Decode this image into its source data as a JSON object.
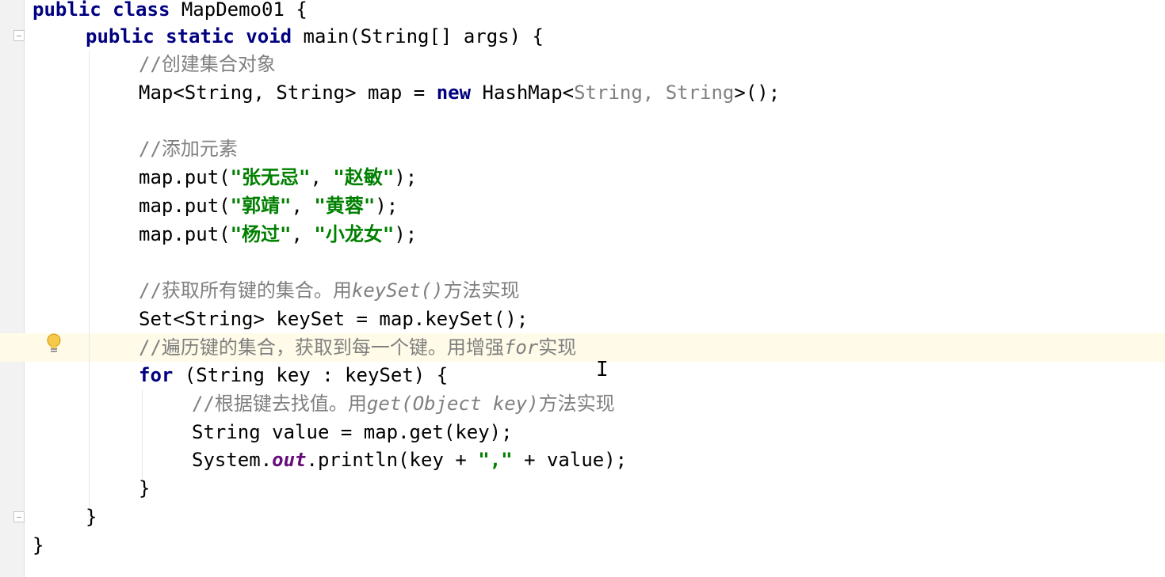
{
  "lines": [
    {
      "kw": "public class",
      "rest": " MapDemo01 {"
    },
    {
      "kw": "public static void",
      "rest": " main(String[] args) {"
    },
    {
      "cmt": "//创建集合对象"
    },
    {
      "pre": "Map<String, String> map = ",
      "kw": "new",
      "mid": " HashMap<",
      "hint": "String, String",
      "post": ">();"
    },
    {},
    {
      "cmt": "//添加元素"
    },
    {
      "pre": "map.put(",
      "s1": "\"张无忌\"",
      "mid": ", ",
      "s2": "\"赵敏\"",
      "post": ");"
    },
    {
      "pre": "map.put(",
      "s1": "\"郭靖\"",
      "mid": ", ",
      "s2": "\"黄蓉\"",
      "post": ");"
    },
    {
      "pre": "map.put(",
      "s1": "\"杨过\"",
      "mid": ", ",
      "s2": "\"小龙女\"",
      "post": ");"
    },
    {},
    {
      "cmt": "//获取所有键的集合。用",
      "cmt_it": "keySet()",
      "cmt2": "方法实现"
    },
    {
      "text": "Set<String> keySet = map.keySet();"
    },
    {
      "cmt": "//遍历键的集合，获取到每一个键。用增强",
      "cmt_it": "for",
      "cmt2": "实现"
    },
    {
      "kw": "for",
      "rest": " (String key : keySet) {"
    },
    {
      "cmt": "//根据键去找值。用",
      "cmt_it": "get(Object key)",
      "cmt2": "方法实现"
    },
    {
      "text": "String value = map.get(key);"
    },
    {
      "pre": "System.",
      "field": "out",
      "mid": ".println(key + ",
      "s1": "\",\"",
      "post": " + value);"
    },
    {
      "text": "}"
    },
    {
      "text": "}"
    },
    {
      "text": "}"
    }
  ],
  "icons": {
    "bulb": "lightbulb-icon",
    "fold": "fold-marker-icon",
    "cursor": "text-cursor-icon"
  },
  "cursor_glyph": "I",
  "colors": {
    "keyword": "#000080",
    "string": "#008000",
    "comment": "#808080",
    "caret_row": "#fffbe8"
  }
}
